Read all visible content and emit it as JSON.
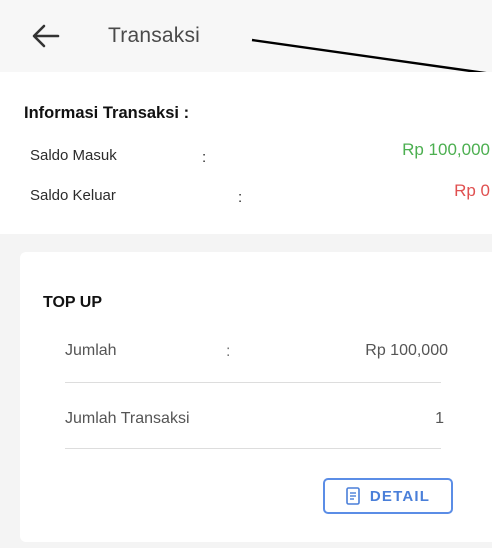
{
  "appbar": {
    "title": "Transaksi",
    "back_icon": "back-arrow-icon"
  },
  "info": {
    "title": "Informasi Transaksi :",
    "saldo_masuk": {
      "label": "Saldo Masuk",
      "colon": ":",
      "value": "Rp 100,000",
      "color": "#4caf50"
    },
    "saldo_keluar": {
      "label": "Saldo Keluar",
      "colon": ":",
      "value": "Rp 0",
      "color": "#e05050"
    }
  },
  "card": {
    "title": "TOP UP",
    "jumlah": {
      "label": "Jumlah",
      "colon": ":",
      "value": "Rp 100,000"
    },
    "jumlah_transaksi": {
      "label": "Jumlah Transaksi",
      "value": "1"
    },
    "detail_button": {
      "label": "DETAIL",
      "icon": "document-icon",
      "color": "#4a7fd9"
    }
  }
}
